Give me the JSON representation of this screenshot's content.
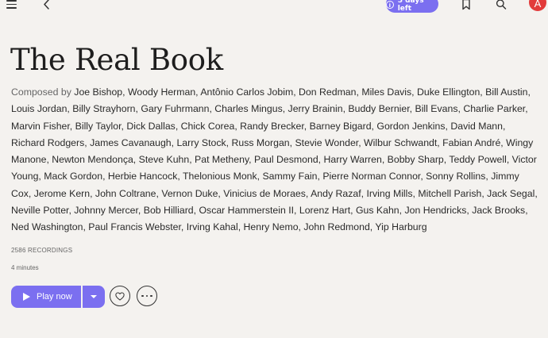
{
  "header": {
    "trial_badge": "5 days left",
    "info_glyph": "i",
    "avatar_initial": "A",
    "colors": {
      "accent": "#7b6ff0",
      "avatar": "#e23b3b"
    }
  },
  "album": {
    "title": "The Real Book",
    "composed_by_label": "Composed by",
    "composers_text": "Joe Bishop, Woody Herman, Antônio Carlos Jobim, Don Redman, Miles Davis, Duke Ellington, Bill Austin, Louis Jordan, Billy Strayhorn, Gary Fuhrmann, Charles Mingus, Jerry Brainin, Buddy Bernier, Bill Evans, Charlie Parker, Marvin Fisher, Billy Taylor, Dick Dallas, Chick Corea, Randy Brecker, Barney Bigard, Gordon Jenkins, David Mann, Richard Rodgers, James Cavanaugh, Larry Stock, Russ Morgan, Stevie Wonder, Wilbur Schwandt, Fabian André, Wingy Manone, Newton Mendonça, Steve Kuhn, Pat Metheny, Paul Desmond, Harry Warren, Bobby Sharp, Teddy Powell, Victor Young, Mack Gordon, Herbie Hancock, Thelonious Monk, Sammy Fain, Pierre Norman Connor, Sonny Rollins, Jimmy Cox, Jerome Kern, John Coltrane, Vernon Duke, Vinicius de Moraes, Andy Razaf, Irving Mills, Mitchell Parish, Jack Segal, Neville Potter, Johnny Mercer, Bob Hilliard, Oscar Hammerstein II, Lorenz Hart, Gus Kahn, Jon Hendricks, Jack Brooks, Ned Washington, Paul Francis Webster, Irving Kahal, Henry Nemo, John Redmond, Yip Harburg",
    "recordings": "2586 RECORDINGS",
    "duration": "4 minutes"
  },
  "actions": {
    "play_label": "Play now"
  },
  "icons": [
    "menu-icon",
    "back-icon",
    "info-icon",
    "bookmark-icon",
    "search-icon",
    "play-icon",
    "chevron-down-icon",
    "heart-icon",
    "more-icon"
  ]
}
